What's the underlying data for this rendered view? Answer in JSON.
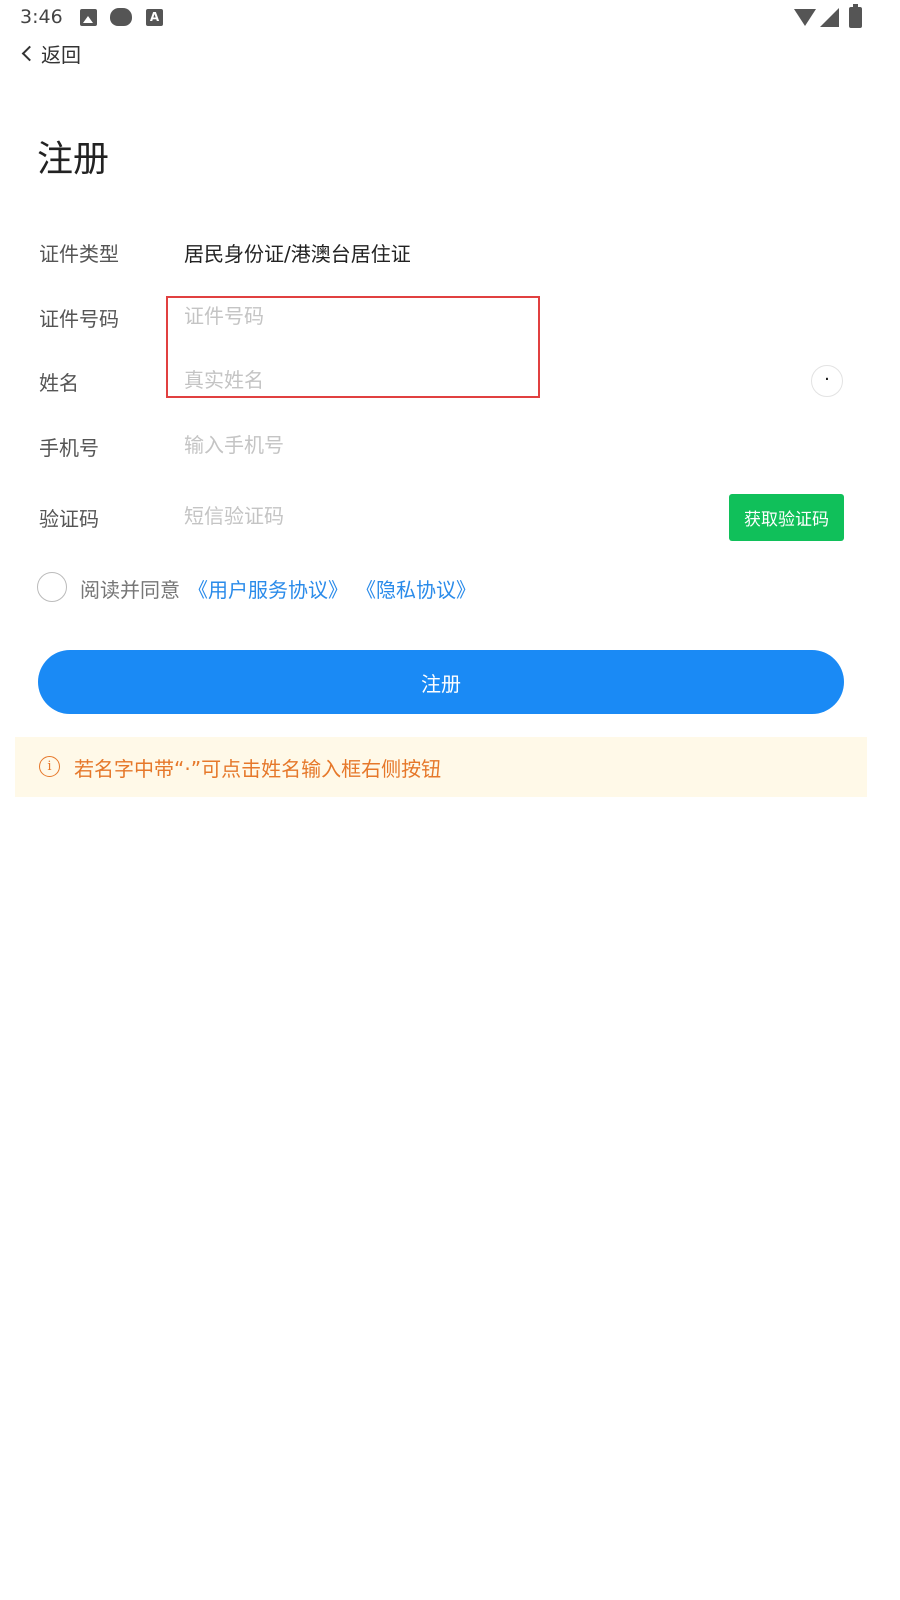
{
  "status_bar": {
    "time": "3:46",
    "icons": [
      "image-icon",
      "bear-icon",
      "app-a-icon",
      "wifi-icon",
      "signal-icon",
      "battery-charging-icon"
    ],
    "a_glyph": "A"
  },
  "nav": {
    "back_label": "返回"
  },
  "page": {
    "title": "注册"
  },
  "form": {
    "id_type": {
      "label": "证件类型",
      "value": "居民身份证/港澳台居住证"
    },
    "id_number": {
      "label": "证件号码",
      "placeholder": "证件号码"
    },
    "name": {
      "label": "姓名",
      "placeholder": "真实姓名",
      "dot_button": "·"
    },
    "phone": {
      "label": "手机号",
      "placeholder": "输入手机号"
    },
    "code": {
      "label": "验证码",
      "placeholder": "短信验证码",
      "button": "获取验证码"
    }
  },
  "agreement": {
    "text": "阅读并同意",
    "terms_link": "《用户服务协议》",
    "privacy_link": "《隐私协议》"
  },
  "register_button": "注册",
  "tip": {
    "icon": "i",
    "text": "若名字中带“·”可点击姓名输入框右侧按钮"
  },
  "colors": {
    "primary_blue": "#1a8af5",
    "link_blue": "#2a8bea",
    "sms_green": "#10c05a",
    "highlight_red": "#e14040",
    "tip_orange": "#e6782a",
    "tip_bg": "#fff9e8"
  }
}
